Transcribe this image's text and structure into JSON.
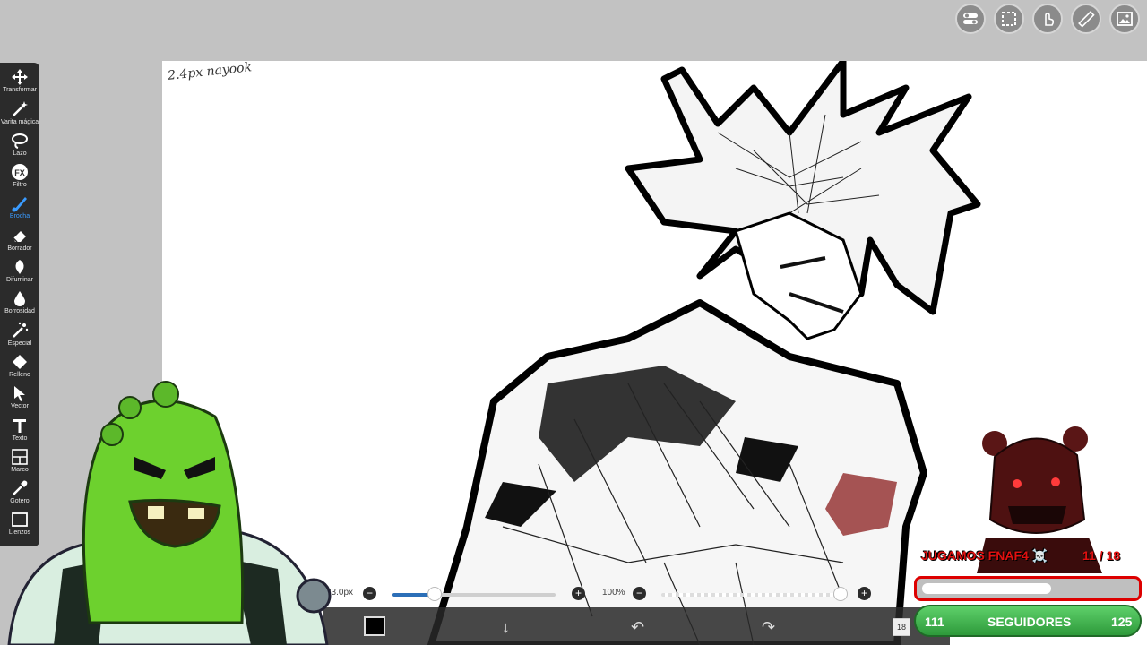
{
  "top_toolbar": {
    "icons": [
      "toggle-icon",
      "selection-icon",
      "touch-icon",
      "ruler-icon",
      "image-icon"
    ]
  },
  "canvas": {
    "note": "2.4px  nayook"
  },
  "tools": [
    {
      "label": "Transformar",
      "icon": "move-icon"
    },
    {
      "label": "Varita mágica",
      "icon": "magic-wand-icon"
    },
    {
      "label": "Lazo",
      "icon": "lasso-icon"
    },
    {
      "label": "Filtro",
      "icon": "fx-icon"
    },
    {
      "label": "Brocha",
      "icon": "brush-icon",
      "active": true
    },
    {
      "label": "Borrador",
      "icon": "eraser-icon"
    },
    {
      "label": "Difuminar",
      "icon": "smudge-icon"
    },
    {
      "label": "Borrosidad",
      "icon": "blur-drop-icon"
    },
    {
      "label": "Especial",
      "icon": "special-wand-icon"
    },
    {
      "label": "Relleno",
      "icon": "fill-bucket-icon"
    },
    {
      "label": "Vector",
      "icon": "vector-cursor-icon"
    },
    {
      "label": "Texto",
      "icon": "text-icon"
    },
    {
      "label": "Marco",
      "icon": "frame-icon"
    },
    {
      "label": "Gotero",
      "icon": "eyedropper-icon"
    },
    {
      "label": "Lienzos",
      "icon": "canvas-icon"
    }
  ],
  "brush_settings": {
    "size": "23.0px",
    "size_fraction": 0.26,
    "opacity": "100%",
    "opacity_fraction": 1.0
  },
  "bottom_toolbar": {
    "color": "#000000",
    "layer_count": "18",
    "icons": [
      "download-icon",
      "undo-icon",
      "redo-icon"
    ]
  },
  "stream_overlay": {
    "goal_title": "JUGAMOS FNAF4 ☠️",
    "goal_count": "11 / 18",
    "goal_progress": 0.61,
    "followers_current": "111",
    "followers_label": "SEGUIDORES",
    "followers_goal": "125"
  },
  "colors": {
    "toolbar_bg": "#2b2b2b",
    "accent": "#3a9bff",
    "overlay_red": "#e01010",
    "followers_green": "#3fb34c"
  }
}
